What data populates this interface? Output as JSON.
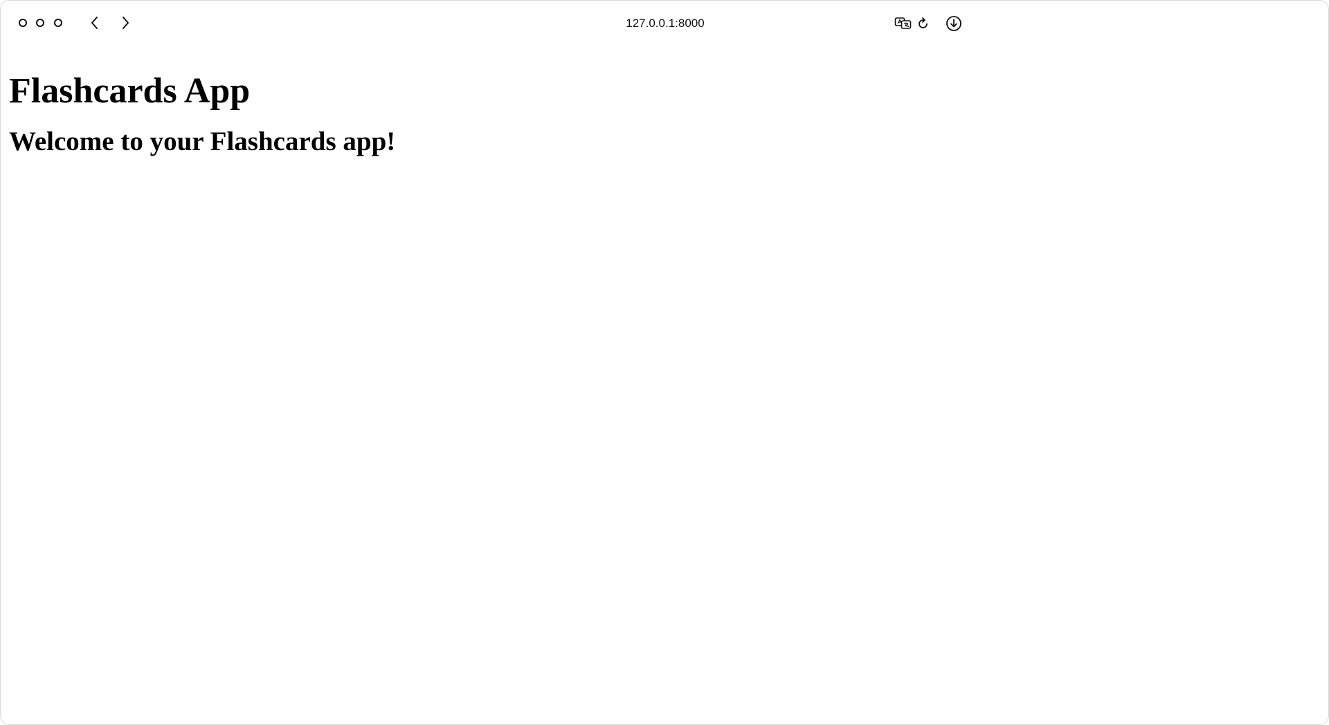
{
  "browser": {
    "address": "127.0.0.1:8000",
    "icons": [
      "window-control-icon",
      "back-icon",
      "forward-icon",
      "translate-icon",
      "reload-icon",
      "download-icon"
    ]
  },
  "page": {
    "title": "Flashcards App",
    "welcome": "Welcome to your Flashcards app!"
  }
}
